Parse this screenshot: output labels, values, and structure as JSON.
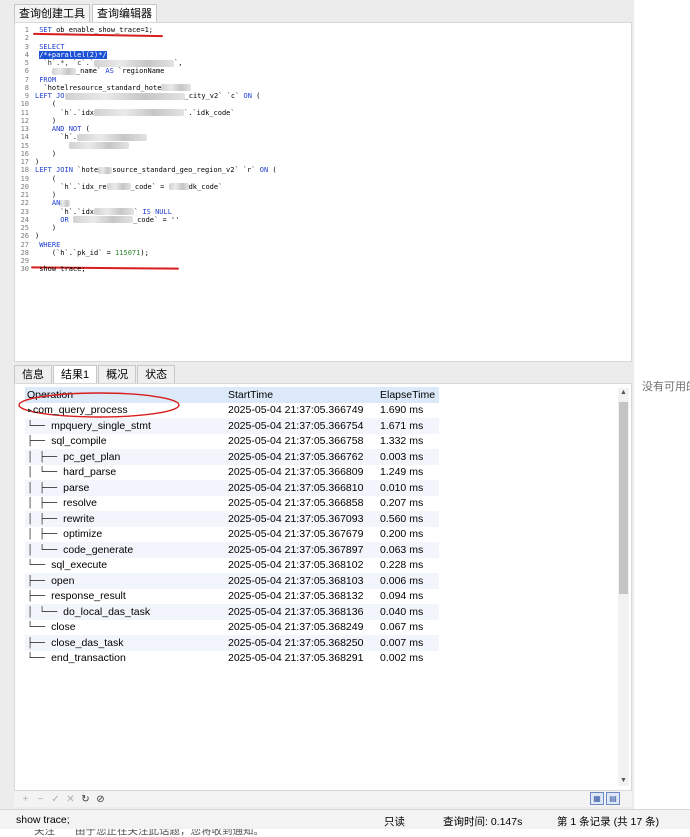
{
  "top_tabs": [
    "查询创建工具",
    "查询编辑器"
  ],
  "editor": {
    "lines": [
      {
        "n": "1",
        "segs": [
          {
            "t": " "
          },
          {
            "t": "SET",
            "c": "kw"
          },
          {
            "t": " ob_enable_show_trace=1;"
          }
        ]
      },
      {
        "n": "2",
        "segs": []
      },
      {
        "n": "3",
        "segs": [
          {
            "t": " "
          },
          {
            "t": "SELECT",
            "c": "kw"
          }
        ]
      },
      {
        "n": "4",
        "segs": [
          {
            "t": " "
          },
          {
            "t": "/*+parallel(2)*/",
            "c": "hl"
          }
        ]
      },
      {
        "n": "5",
        "segs": [
          {
            "t": "  `h`.*, `c`.`",
            "c": "str"
          },
          {
            "b": 80
          },
          {
            "t": "`,"
          }
        ]
      },
      {
        "n": "6",
        "segs": [
          {
            "t": "    "
          },
          {
            "b": 24
          },
          {
            "t": "_name` "
          },
          {
            "t": "AS",
            "c": "kw"
          },
          {
            "t": " `regionName"
          }
        ]
      },
      {
        "n": "7",
        "segs": [
          {
            "t": " "
          },
          {
            "t": "FROM",
            "c": "kw"
          }
        ]
      },
      {
        "n": "8",
        "segs": [
          {
            "t": "  `hotelresource_standard_hote"
          },
          {
            "b": 30
          }
        ]
      },
      {
        "n": "9",
        "segs": [
          {
            "t": ""
          },
          {
            "t": "LEFT JO",
            "c": "kw"
          },
          {
            "b": 120
          },
          {
            "t": "_city_v2` `c` "
          },
          {
            "t": "ON",
            "c": "kw"
          },
          {
            "t": " ("
          }
        ]
      },
      {
        "n": "10",
        "segs": [
          {
            "t": "    ("
          }
        ]
      },
      {
        "n": "11",
        "segs": [
          {
            "t": "      `h`.`idx"
          },
          {
            "b": 90
          },
          {
            "t": "`.`idk_code`"
          }
        ]
      },
      {
        "n": "12",
        "segs": [
          {
            "t": "    )"
          }
        ]
      },
      {
        "n": "13",
        "segs": [
          {
            "t": "    "
          },
          {
            "t": "AND NOT",
            "c": "kw"
          },
          {
            "t": " ("
          }
        ]
      },
      {
        "n": "14",
        "segs": [
          {
            "t": "      `h`."
          },
          {
            "b": 70
          }
        ]
      },
      {
        "n": "15",
        "segs": [
          {
            "t": "        "
          },
          {
            "b": 60
          }
        ]
      },
      {
        "n": "16",
        "segs": [
          {
            "t": "    )"
          }
        ]
      },
      {
        "n": "17",
        "segs": [
          {
            "t": ")"
          }
        ]
      },
      {
        "n": "18",
        "segs": [
          {
            "t": ""
          },
          {
            "t": "LEFT JOIN",
            "c": "kw"
          },
          {
            "t": " `hote"
          },
          {
            "b": 14
          },
          {
            "t": "source_standard_geo_region_v2` `r` "
          },
          {
            "t": "ON",
            "c": "kw"
          },
          {
            "t": " ("
          }
        ]
      },
      {
        "n": "19",
        "segs": [
          {
            "t": "    ("
          }
        ]
      },
      {
        "n": "20",
        "segs": [
          {
            "t": "      `h`.`idx_re"
          },
          {
            "b": 24
          },
          {
            "t": "_code` = "
          },
          {
            "b": 20
          },
          {
            "t": "dk_code`"
          }
        ]
      },
      {
        "n": "21",
        "segs": [
          {
            "t": "    )"
          }
        ]
      },
      {
        "n": "22",
        "segs": [
          {
            "t": "    "
          },
          {
            "t": "AN",
            "c": "kw"
          },
          {
            "b": 10
          }
        ]
      },
      {
        "n": "23",
        "segs": [
          {
            "t": "      `h`.`idx"
          },
          {
            "b": 40
          },
          {
            "t": "` "
          },
          {
            "t": "IS NULL",
            "c": "kw"
          }
        ]
      },
      {
        "n": "24",
        "segs": [
          {
            "t": "      "
          },
          {
            "t": "OR",
            "c": "kw"
          },
          {
            "t": " "
          },
          {
            "b": 60
          },
          {
            "t": "_code` = ''"
          }
        ]
      },
      {
        "n": "25",
        "segs": [
          {
            "t": "    )"
          }
        ]
      },
      {
        "n": "26",
        "segs": [
          {
            "t": ")"
          }
        ]
      },
      {
        "n": "27",
        "segs": [
          {
            "t": " "
          },
          {
            "t": "WHERE",
            "c": "kw"
          }
        ]
      },
      {
        "n": "28",
        "segs": [
          {
            "t": "    (`h`.`pk_id` = "
          },
          {
            "t": "115071",
            "c": "num"
          },
          {
            "t": ");"
          }
        ]
      },
      {
        "n": "29",
        "segs": []
      },
      {
        "n": "30",
        "segs": [
          {
            "t": " show trace;"
          }
        ]
      }
    ]
  },
  "result_tabs": [
    "信息",
    "结果1",
    "概况",
    "状态"
  ],
  "grid": {
    "columns": [
      "Operation",
      "StartTime",
      "ElapseTime"
    ],
    "rows": [
      {
        "tree": "",
        "op": "com_query_process",
        "start": "2025-05-04 21:37:05.366749",
        "elapse": "1.690 ms"
      },
      {
        "tree": "└── ",
        "op": "mpquery_single_stmt",
        "start": "2025-05-04 21:37:05.366754",
        "elapse": "1.671 ms"
      },
      {
        "tree": "  ├── ",
        "op": "sql_compile",
        "start": "2025-05-04 21:37:05.366758",
        "elapse": "1.332 ms"
      },
      {
        "tree": "  │ ├── ",
        "op": "pc_get_plan",
        "start": "2025-05-04 21:37:05.366762",
        "elapse": "0.003 ms"
      },
      {
        "tree": "  │ └── ",
        "op": "hard_parse",
        "start": "2025-05-04 21:37:05.366809",
        "elapse": "1.249 ms"
      },
      {
        "tree": "  │   ├── ",
        "op": "parse",
        "start": "2025-05-04 21:37:05.366810",
        "elapse": "0.010 ms"
      },
      {
        "tree": "  │   ├── ",
        "op": "resolve",
        "start": "2025-05-04 21:37:05.366858",
        "elapse": "0.207 ms"
      },
      {
        "tree": "  │   ├── ",
        "op": "rewrite",
        "start": "2025-05-04 21:37:05.367093",
        "elapse": "0.560 ms"
      },
      {
        "tree": "  │   ├── ",
        "op": "optimize",
        "start": "2025-05-04 21:37:05.367679",
        "elapse": "0.200 ms"
      },
      {
        "tree": "  │   └── ",
        "op": "code_generate",
        "start": "2025-05-04 21:37:05.367897",
        "elapse": "0.063 ms"
      },
      {
        "tree": "  └── ",
        "op": "sql_execute",
        "start": "2025-05-04 21:37:05.368102",
        "elapse": "0.228 ms"
      },
      {
        "tree": "    ├── ",
        "op": "open",
        "start": "2025-05-04 21:37:05.368103",
        "elapse": "0.006 ms"
      },
      {
        "tree": "    ├── ",
        "op": "response_result",
        "start": "2025-05-04 21:37:05.368132",
        "elapse": "0.094 ms"
      },
      {
        "tree": "    │ └── ",
        "op": "do_local_das_task",
        "start": "2025-05-04 21:37:05.368136",
        "elapse": "0.040 ms"
      },
      {
        "tree": "    └── ",
        "op": "close",
        "start": "2025-05-04 21:37:05.368249",
        "elapse": "0.067 ms"
      },
      {
        "tree": "      ├── ",
        "op": "close_das_task",
        "start": "2025-05-04 21:37:05.368250",
        "elapse": "0.007 ms"
      },
      {
        "tree": "      └── ",
        "op": "end_transaction",
        "start": "2025-05-04 21:37:05.368291",
        "elapse": "0.002 ms"
      }
    ]
  },
  "right_panel": {
    "text": "没有可用的"
  },
  "toolbar_icons": [
    "+",
    "−",
    "✓",
    "✕",
    "↻",
    "⊘"
  ],
  "status": {
    "query": "show trace;",
    "mode": "只读",
    "query_time": "查询时间: 0.147s",
    "record": "第 1 条记录 (共 17 条)"
  },
  "underlay": {
    "left": "关注",
    "mid": "由于您正在关注此话题，您将收到通知。"
  },
  "colors": {
    "annotation": "#d81e1e",
    "keyword": "#1f3fd0",
    "selection": "#1d52d6"
  }
}
